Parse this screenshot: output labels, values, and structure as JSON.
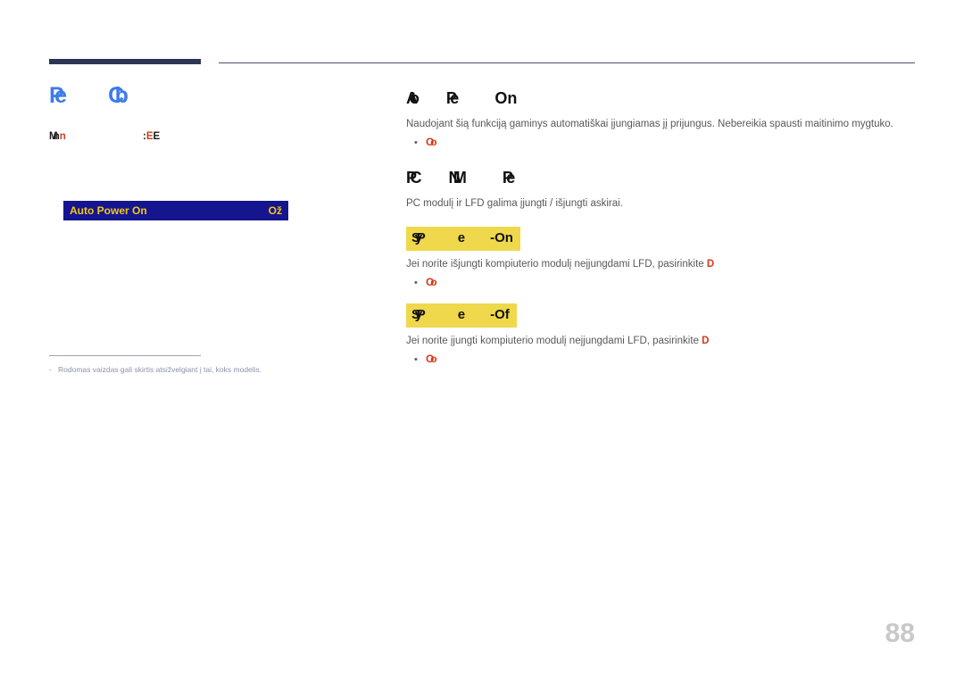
{
  "document": {
    "language": "lt",
    "page_number": "88"
  },
  "colors": {
    "chapter_title": "#3d7bec",
    "rule_dark": "#2c3553",
    "osd_background": "#15158f",
    "osd_text": "#f5c518",
    "highlight_chip": "#efd84b",
    "accent_red": "#d23a1b",
    "body_text": "#58585a",
    "footnote_text": "#8d93ab",
    "page_number": "#c8c8c8"
  },
  "left_column": {
    "chapter_title_part1": "Pe",
    "chapter_title_part2": "Cb",
    "menu_path_label": "Mn",
    "menu_path_label_accent": "n",
    "menu_path_separator": ":",
    "menu_path_value_accent": "E",
    "menu_path_value": "E",
    "osd": {
      "label": "Auto Power On",
      "value": "Ož"
    },
    "footnote": {
      "dash": "-",
      "text": "Rodomas vaizdas gali skirtis atsižvelgiant į tai, koks modelis."
    }
  },
  "right_column": {
    "section1": {
      "heading_part1": "Ato",
      "heading_part2": "Pe",
      "heading_part3": "On",
      "paragraph": "Naudojant šią funkciją gaminys automatiškai įjungiamas jį prijungus. Nebereikia spausti maitinimo mygtuko.",
      "bullet": "Oo"
    },
    "section2": {
      "heading_part1": "PC",
      "heading_part2": "NM",
      "heading_part3": "Pe",
      "paragraph": "PC modulį ir LFD galima įjungti / išjungti askirai.",
      "options": [
        {
          "chip_part1": "SyP",
          "chip_part2": "e",
          "chip_part3": "-On",
          "description_prefix": "Jei norite išjungti kompiuterio modulį neįjungdami LFD, pasirinkite ",
          "description_accent": "D",
          "bullet": "Oo"
        },
        {
          "chip_part1": "SyP",
          "chip_part2": "e",
          "chip_part3": "-Of",
          "description_prefix": "Jei norite įjungti kompiuterio modulį neįjungdami LFD, pasirinkite ",
          "description_accent": "D",
          "bullet": "Oo"
        }
      ]
    }
  }
}
